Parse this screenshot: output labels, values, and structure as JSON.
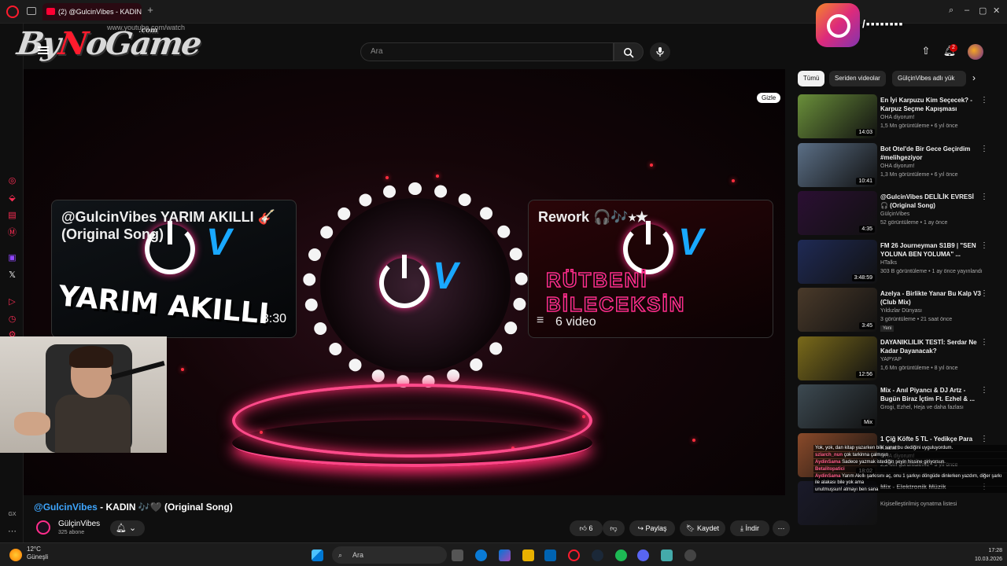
{
  "browser": {
    "tab_title": "(2) @GulcinVibes - KADIN",
    "url": "www.youtube.com/watch"
  },
  "overlay": {
    "watermark_text": "ByNoGame",
    "watermark_sub": ".com",
    "ig_handle": "/▪▪▪▪▪▪▪▪"
  },
  "header": {
    "search_placeholder": "Ara",
    "notification_count": "2"
  },
  "player": {
    "hide_label": "Gizle",
    "cards": [
      {
        "title": "@GulcinVibes YARIM AKILLI 🎸 (Original Song)",
        "art_text": "YARIM AKILLI",
        "duration": "3:30"
      },
      {
        "title": "Rework 🎧🎶⭑★",
        "art_text": "RÜTBENİ BİLECEKSİN",
        "video_count": "6 video"
      }
    ]
  },
  "video": {
    "mention": "@GulcinVibes",
    "title_rest": " - KADIN 🎶🖤 (Original Song)",
    "channel_name": "GülçinVibes",
    "subscribers": "325 abone",
    "likes": "6",
    "share": "Paylaş",
    "save": "Kaydet",
    "download": "İndir"
  },
  "chips": [
    "Tümü",
    "Seriden videolar",
    "GülçinVibes adlı yük"
  ],
  "recommendations": [
    {
      "title": "En İyi Karpuzu Kim Seçecek? - Karpuz Seçme Kapışması",
      "channel": "OHA diyorum!",
      "meta": "1,5 Mn görüntüleme • 6 yıl önce",
      "duration": "14:03",
      "color": "#6a8f3a"
    },
    {
      "title": "Bot Otel'de Bir Gece Geçirdim #melihgeziyor",
      "channel": "OHA diyorum!",
      "meta": "1,3 Mn görüntüleme • 6 yıl önce",
      "duration": "10:41",
      "color": "#5b6f86"
    },
    {
      "title": "@GulcinVibes DELİLİK EVRESİ 🎧 (Original Song)",
      "channel": "GülçinVibes",
      "meta": "52 görüntüleme • 1 ay önce",
      "duration": "4:35",
      "color": "#2b0f33"
    },
    {
      "title": "FM 26 Journeyman S1B9 | \"SEN YOLUNA BEN YOLUMA\" ...",
      "channel": "HTalks",
      "meta": "303 B görüntüleme • 1 ay önce yayınlandı",
      "duration": "3:48:59",
      "color": "#1f2a55"
    },
    {
      "title": "Azelya - Birlikte Yanar Bu Kalp V3 (Club Mix)",
      "channel": "Yıldızlar Dünyası",
      "meta": "3 görüntüleme • 21 saat önce",
      "duration": "3:45",
      "color": "#4a3a2a",
      "badge": "Yeni"
    },
    {
      "title": "DAYANIKLILIK TESTİ: Serdar Ne Kadar Dayanacak?",
      "channel": "YAPYAP",
      "meta": "1,6 Mn görüntüleme • 8 yıl önce",
      "duration": "12:56",
      "color": "#7a6a1a"
    },
    {
      "title": "Mix - Anıl Piyancı & DJ Artz - Bugün Biraz İçtim Ft. Ezhel & ...",
      "channel": "Grogi, Ezhel, Heja ve daha fazlası",
      "meta": "",
      "duration": "Mix",
      "color": "#3d4a52"
    },
    {
      "title": "1 Çiğ Köfte 5 TL - Yedikçe Para Kazan",
      "channel": "OHA diyorum!",
      "meta": "2,2 Mn görüntüleme • 5 yıl önce",
      "duration": "18:02",
      "color": "#8a4a2a"
    },
    {
      "title": "Mix - Elektronik Müzik",
      "channel": "Kişiselleştirilmiş oynatma listesi",
      "meta": "",
      "duration": "",
      "color": "#1a1a2a"
    }
  ],
  "chat": [
    {
      "user": "",
      "text": "Yok, yok, dan kitap yazarken bile sanat bu dediğini uyguluyordum."
    },
    {
      "user": "szlarch_nun",
      "text": "çok tarkinna çalmışın"
    },
    {
      "user": "AydinSama",
      "text": "Sadece yazmak istediğin şeyin hissine giriyorsun."
    },
    {
      "user": "Betalitopatici",
      "text": ""
    },
    {
      "user": "AydinSama",
      "text": "Yarım Akıllı şarkısını aç, onu 1 şarkıyı döngüde dinlerken yazdım, diğer şarkı ile alakası bile yok ama"
    },
    {
      "user": "",
      "text": "unutmuşsun! atmayı ben sana"
    }
  ],
  "taskbar": {
    "temperature": "12°C",
    "weather": "Güneşli",
    "search": "Ara",
    "time": "17:28",
    "date": "10.03.2026"
  },
  "colors": {
    "accent": "#ff2d8a",
    "brand": "#ff0033",
    "link": "#3ea6ff"
  }
}
